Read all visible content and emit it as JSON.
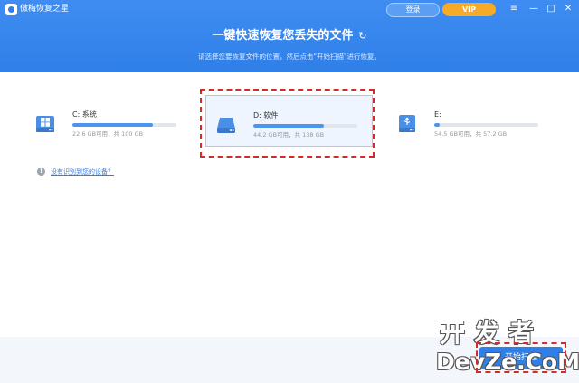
{
  "app": {
    "name": "傲梅恢复之星"
  },
  "header": {
    "login_label": "登录",
    "vip_label": "VIP",
    "title": "一键快速恢复您丢失的文件",
    "subtitle": "请选择您要恢复文件的位置，然后点击\"开始扫描\"进行恢复。"
  },
  "window_controls": {
    "menu": "≡",
    "minimize": "—",
    "maximize": "□",
    "close": "✕"
  },
  "drives": [
    {
      "name": "C: 系统",
      "size": "22.6 GB可用，共 100 GB",
      "used_fraction": 0.77,
      "icon": "windows-drive-icon",
      "selected": false
    },
    {
      "name": "D: 软件",
      "size": "44.2 GB可用，共 138 GB",
      "used_fraction": 0.68,
      "icon": "hard-drive-icon",
      "selected": true
    },
    {
      "name": "E:",
      "size": "54.5 GB可用，共 57.2 GB",
      "used_fraction": 0.05,
      "icon": "usb-drive-icon",
      "selected": false
    }
  ],
  "help": {
    "link": "没有识别到您的设备？"
  },
  "footer": {
    "scan_button": "开始扫描"
  },
  "watermark": {
    "top": "开发者",
    "bottom": "DevZe.CoM"
  },
  "colors": {
    "accent": "#2f7fe8",
    "vip": "#f7a928",
    "highlight": "#d32a2a"
  }
}
